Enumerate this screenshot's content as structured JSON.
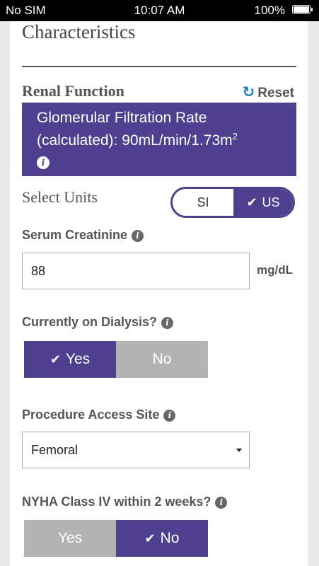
{
  "status_bar": {
    "carrier": "No SIM",
    "time": "10:07 AM",
    "battery_percent": "100%"
  },
  "section": {
    "title": "Characteristics"
  },
  "renal": {
    "label": "Renal Function",
    "reset_label": "Reset",
    "gfr_line1": "Glomerular Filtration Rate",
    "gfr_line2": "(calculated): 90mL/min/1.73m",
    "gfr_superscript": "2"
  },
  "units": {
    "label": "Select Units",
    "options": [
      "SI",
      "US"
    ],
    "selected": "US"
  },
  "serum_creatinine": {
    "label": "Serum Creatinine",
    "value": "88",
    "unit": "mg/dL"
  },
  "dialysis": {
    "label": "Currently on Dialysis?",
    "options": [
      "Yes",
      "No"
    ],
    "selected": "Yes"
  },
  "access_site": {
    "label": "Procedure Access Site",
    "selected": "Femoral"
  },
  "nyha": {
    "label": "NYHA Class IV within 2 weeks?",
    "options": [
      "Yes",
      "No"
    ],
    "selected": "No"
  },
  "colors": {
    "accent": "#4e3f8f",
    "inactive": "#b3b3b3",
    "reset_icon": "#1a7fc8"
  },
  "icons": {
    "info": "info-icon",
    "check": "check-icon",
    "reset": "refresh-icon",
    "dropdown": "caret-down-icon"
  }
}
